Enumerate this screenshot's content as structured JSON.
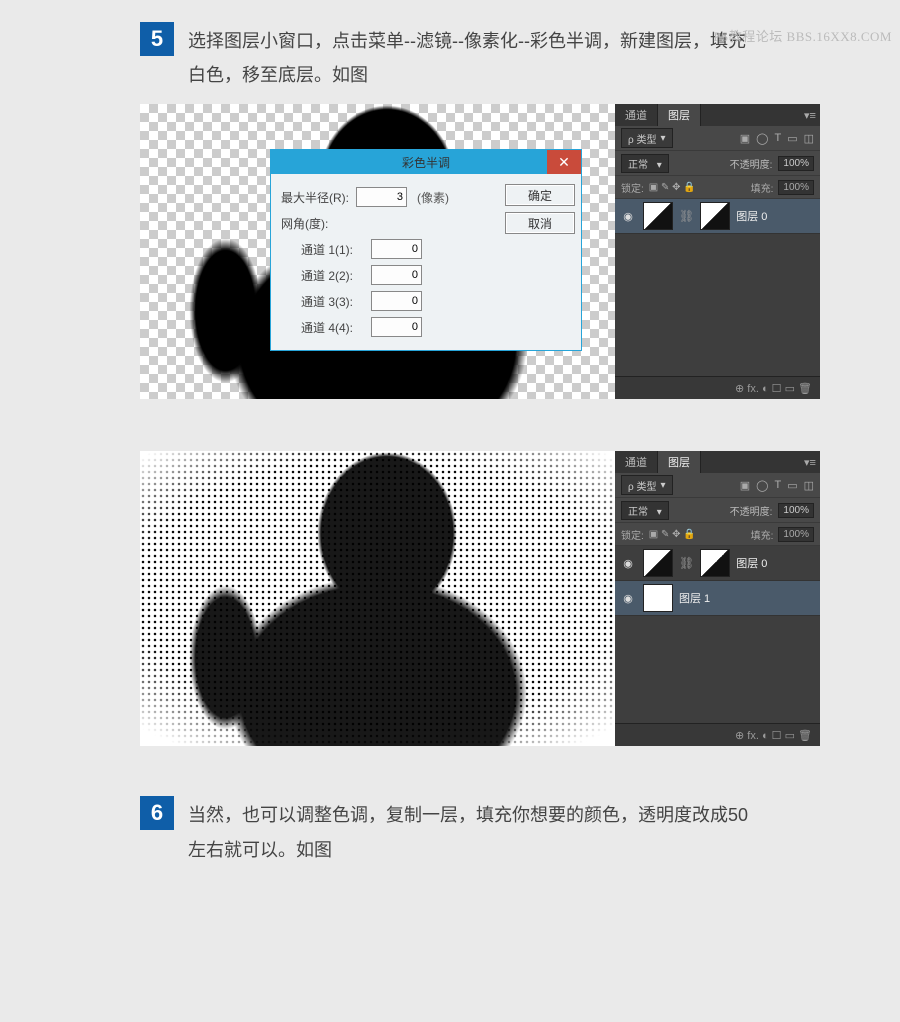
{
  "watermark": "PS教程论坛  BBS.16XX8.COM",
  "steps": {
    "s5": {
      "num": "5",
      "text": "选择图层小窗口，点击菜单--滤镜--像素化--彩色半调，新建图层，填充白色，移至底层。如图"
    },
    "s6": {
      "num": "6",
      "text": "当然，也可以调整色调，复制一层，填充你想要的颜色，透明度改成50左右就可以。如图"
    }
  },
  "dialog": {
    "title": "彩色半调",
    "close": "✕",
    "maxRadiusLabel": "最大半径(R):",
    "maxRadiusValue": "3",
    "unit": "(像素)",
    "gridAngleLabel": "网角(度):",
    "channels": {
      "c1l": "通道 1(1):",
      "c1v": "0",
      "c2l": "通道 2(2):",
      "c2v": "0",
      "c3l": "通道 3(3):",
      "c3v": "0",
      "c4l": "通道 4(4):",
      "c4v": "0"
    },
    "ok": "确定",
    "cancel": "取消"
  },
  "panel": {
    "tab1": "通道",
    "tab2": "图层",
    "menuGlyph": "▾≡",
    "kindLabel": "ρ 类型",
    "kindArrow": "▾",
    "icons": {
      "img": "▣",
      "fx": "◯",
      "T": "T",
      "shape": "▭",
      "smart": "◫"
    },
    "blend": "正常",
    "opacityLabel": "不透明度:",
    "opacityValue": "100%",
    "lockLabel": "锁定:",
    "lockIcons": "▣  ✎  ✥  🔒",
    "fillLabel": "填充:",
    "fillValue": "100%",
    "layer0": "图层 0",
    "layer1": "图层 1",
    "eye": "◉",
    "chain": "⛓",
    "footerIcons": "⊕  fx.  ◐  ☐  ▭  🗑"
  }
}
